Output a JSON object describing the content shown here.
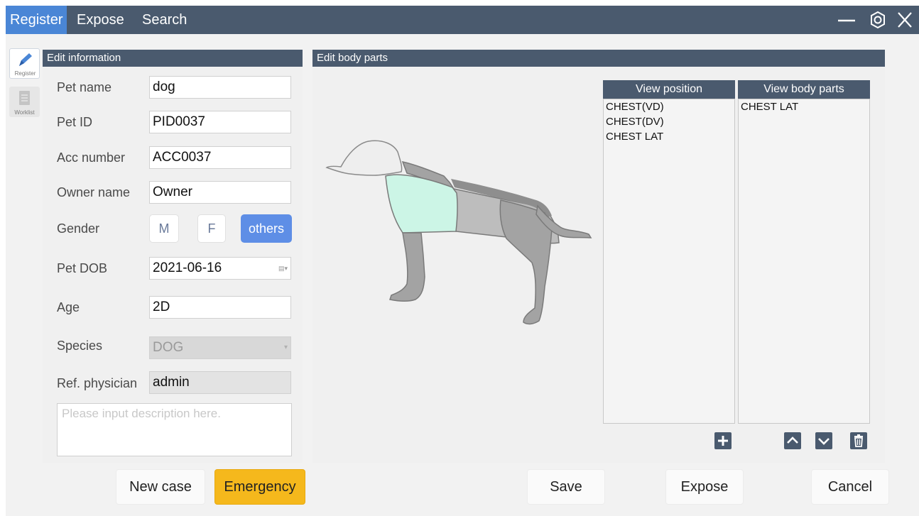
{
  "topbar": {
    "tabs": [
      {
        "label": "Register",
        "active": true
      },
      {
        "label": "Expose",
        "active": false
      },
      {
        "label": "Search",
        "active": false
      }
    ],
    "controls": {
      "minimize_icon": "minimize-icon",
      "settings_icon": "gear-icon",
      "close_icon": "close-icon"
    }
  },
  "sidebar": {
    "items": [
      {
        "label": "Register",
        "icon": "pencil-icon",
        "active": true
      },
      {
        "label": "Worklist",
        "icon": "document-icon",
        "active": false
      }
    ]
  },
  "edit_info": {
    "title": "Edit information",
    "pet_name": {
      "label": "Pet name",
      "value": "dog"
    },
    "pet_id": {
      "label": "Pet ID",
      "value": "PID0037"
    },
    "acc_number": {
      "label": "Acc number",
      "value": "ACC0037"
    },
    "owner_name": {
      "label": "Owner name",
      "value": "Owner"
    },
    "gender": {
      "label": "Gender",
      "options": [
        "M",
        "F",
        "others"
      ],
      "selected": "others"
    },
    "pet_dob": {
      "label": "Pet DOB",
      "value": "2021-06-16"
    },
    "age": {
      "label": "Age",
      "value": "2D"
    },
    "species": {
      "label": "Species",
      "value": "DOG"
    },
    "ref_physician": {
      "label": "Ref. physician",
      "value": "admin"
    },
    "description": {
      "placeholder": "Please input description here."
    }
  },
  "body_parts": {
    "title": "Edit body parts",
    "view_position": {
      "header": "View position",
      "items": [
        "CHEST(VD)",
        "CHEST(DV)",
        "CHEST LAT"
      ]
    },
    "view_body_parts": {
      "header": "View body parts",
      "items": [
        "CHEST LAT"
      ]
    },
    "icons": {
      "add": "plus-icon",
      "up": "chevron-up-icon",
      "down": "chevron-down-icon",
      "delete": "trash-icon"
    }
  },
  "actions": {
    "new_case": "New case",
    "emergency": "Emergency",
    "save": "Save",
    "expose": "Expose",
    "cancel": "Cancel"
  },
  "colors": {
    "header": "#4a5a6e",
    "accent": "#5e8ee6",
    "active_tab": "#4a86d6",
    "emergency": "#f5b81c",
    "highlight_region": "#ccf5e6"
  }
}
